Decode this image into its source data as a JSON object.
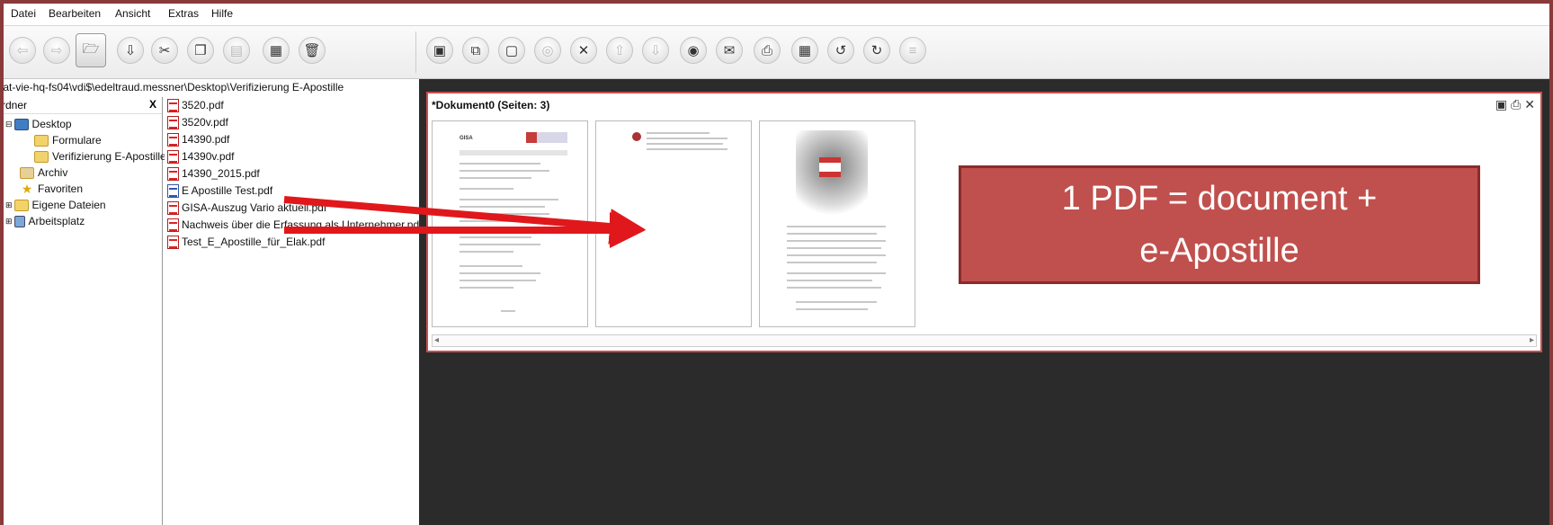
{
  "menu": {
    "items": [
      "Datei",
      "Bearbeiten",
      "Ansicht",
      "Extras",
      "Hilfe"
    ]
  },
  "toolbar": {
    "left_icons": [
      "back-arrow-icon",
      "forward-arrow-icon",
      "open-folder-icon",
      "download-icon",
      "scissors-icon",
      "copy-icon",
      "paste-icon",
      "calculator-icon",
      "trash-icon"
    ],
    "right_icons": [
      "save-icon",
      "save-as-icon",
      "blank-page-icon",
      "rings-icon",
      "close-doc-icon",
      "up-arrow-icon",
      "down-arrow-icon",
      "eye-icon",
      "mail-icon",
      "print-icon",
      "calculator2-icon",
      "rotate-left-icon",
      "rotate-right-icon",
      "align-icon"
    ]
  },
  "path": {
    "text": "\\at-vie-hq-fs04\\vdi$\\edeltraud.messner\\Desktop\\Verifizierung E-Apostille"
  },
  "folders": {
    "header": "rdner",
    "close": "X",
    "items": [
      {
        "label": "Desktop",
        "icon": "desktop-icon"
      },
      {
        "label": "Formulare",
        "icon": "folder-icon"
      },
      {
        "label": "Verifizierung E-Apostille",
        "icon": "folder-icon"
      },
      {
        "label": "Archiv",
        "icon": "archive-icon"
      },
      {
        "label": "Favoriten",
        "icon": "star-icon"
      },
      {
        "label": "Eigene Dateien",
        "icon": "folder-icon"
      },
      {
        "label": "Arbeitsplatz",
        "icon": "computer-icon"
      }
    ]
  },
  "files": [
    {
      "name": "3520.pdf"
    },
    {
      "name": "3520v.pdf"
    },
    {
      "name": "14390.pdf"
    },
    {
      "name": "14390v.pdf"
    },
    {
      "name": "14390_2015.pdf"
    },
    {
      "name": "E Apostille Test.pdf"
    },
    {
      "name": "GISA-Auszug Vario aktuell.pdf"
    },
    {
      "name": "Nachweis über die Erfassung als Unternehmer.pdf"
    },
    {
      "name": "Test_E_Apostille_für_Elak.pdf"
    }
  ],
  "document": {
    "title": "*Dokument0 (Seiten: 3)",
    "page_count": 3
  },
  "callout": {
    "line1": "1 PDF = document +",
    "line2": "e-Apostille"
  },
  "colors": {
    "callout_bg": "#c0504d",
    "arrow": "#e0181c",
    "viewer_bg": "#2b2b2b",
    "frame_border": "#8a3a3a"
  }
}
